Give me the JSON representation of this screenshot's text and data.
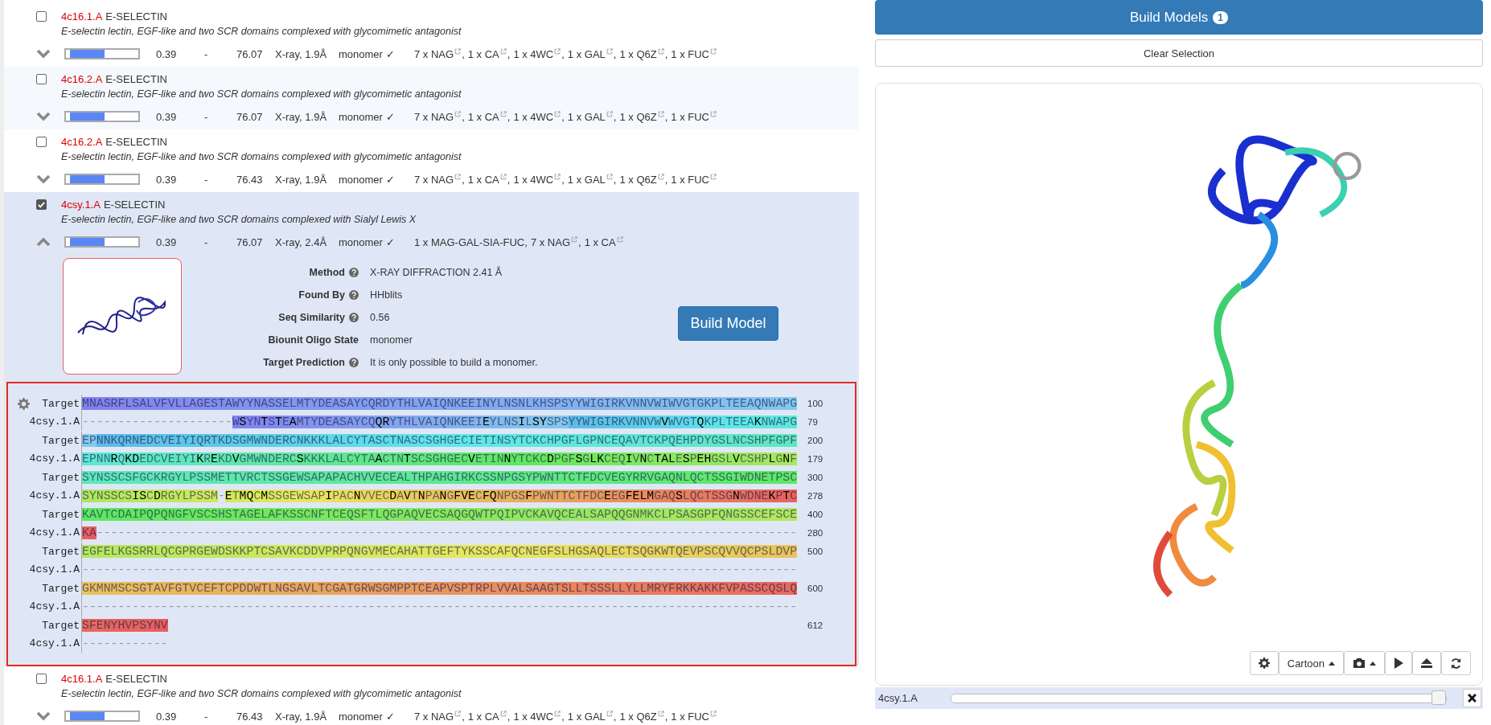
{
  "results": [
    {
      "id": "4c16.1.A",
      "name": "E-SELECTIN",
      "description": "E-selectin lectin, EGF-like and two SCR domains complexed with glycomimetic antagonist",
      "selected": false,
      "expanded": false,
      "level": 0.48,
      "column_3": "0.39",
      "column_4": "-",
      "column_5": "76.07",
      "column_6": "X-ray, 1.9Å",
      "column_7": "monomer ✓",
      "ligands": [
        {
          "text": "7 x NAG",
          "link": true,
          "separator": ","
        },
        {
          "text": "1 x CA",
          "link": true,
          "separator": ","
        },
        {
          "text": "1 x 4WC",
          "link": true,
          "separator": ","
        },
        {
          "text": "1 x GAL",
          "link": true,
          "separator": ","
        },
        {
          "text": "1 x Q6Z",
          "link": true,
          "separator": ","
        },
        {
          "text": "1 x FUC",
          "link": true
        }
      ]
    },
    {
      "id": "4c16.2.A",
      "name": "E-SELECTIN",
      "description": "E-selectin lectin, EGF-like and two SCR domains complexed with glycomimetic antagonist",
      "selected": false,
      "expanded": false,
      "level": 0.48,
      "column_3": "0.39",
      "column_4": "-",
      "column_5": "76.07",
      "column_6": "X-ray, 1.9Å",
      "column_7": "monomer ✓",
      "ligands": [
        {
          "text": "7 x NAG",
          "link": true,
          "separator": ","
        },
        {
          "text": "1 x CA",
          "link": true,
          "separator": ","
        },
        {
          "text": "1 x 4WC",
          "link": true,
          "separator": ","
        },
        {
          "text": "1 x GAL",
          "link": true,
          "separator": ","
        },
        {
          "text": "1 x Q6Z",
          "link": true,
          "separator": ","
        },
        {
          "text": "1 x FUC",
          "link": true
        }
      ]
    },
    {
      "id": "4c16.2.A",
      "name": "E-SELECTIN",
      "description": "E-selectin lectin, EGF-like and two SCR domains complexed with glycomimetic antagonist",
      "selected": false,
      "expanded": false,
      "level": 0.48,
      "column_3": "0.39",
      "column_4": "-",
      "column_5": "76.43",
      "column_6": "X-ray, 1.9Å",
      "column_7": "monomer ✓",
      "ligands": [
        {
          "text": "7 x NAG",
          "link": true,
          "separator": ","
        },
        {
          "text": "1 x CA",
          "link": true,
          "separator": ","
        },
        {
          "text": "1 x 4WC",
          "link": true,
          "separator": ","
        },
        {
          "text": "1 x GAL",
          "link": true,
          "separator": ","
        },
        {
          "text": "1 x Q6Z",
          "link": true,
          "separator": ","
        },
        {
          "text": "1 x FUC",
          "link": true
        }
      ]
    },
    {
      "id": "4csy.1.A",
      "name": "E-SELECTIN",
      "description": "E-selectin lectin, EGF-like and two SCR domains complexed with Sialyl Lewis X",
      "selected": true,
      "expanded": true,
      "level": 0.48,
      "column_3": "0.39",
      "column_4": "-",
      "column_5": "76.07",
      "column_6": "X-ray, 2.4Å",
      "column_7": "monomer ✓",
      "ligands": [
        {
          "text": "1 x MAG-GAL-SIA-FUC",
          "link": false,
          "separator": ","
        },
        {
          "text": "7 x NAG",
          "link": true,
          "separator": ","
        },
        {
          "text": "1 x CA",
          "link": true
        }
      ],
      "details": {
        "fields": [
          {
            "label": "Method",
            "help": true,
            "value": "X-RAY DIFFRACTION 2.41 Å"
          },
          {
            "label": "Found By",
            "help": true,
            "value": "HHblits"
          },
          {
            "label": "Seq Similarity",
            "help": true,
            "value": "0.56"
          },
          {
            "label": "Biounit Oligo State",
            "help": false,
            "value": "monomer"
          },
          {
            "label": "Target Prediction",
            "help": true,
            "value": "It is only possible to build a monomer."
          }
        ],
        "build_button": "Build Model",
        "alignment": [
          {
            "target_label": "Target",
            "target": "MNASRFLSALVFVLLAGESTAWYYNASSELMTYDEASAYCQRDYTHLVAIQNKEEINYLNSNLKHSPSYYWIGIRKVNNVWIWVGTGKPLTEEAQNWAPG",
            "target_end": "100",
            "template_label": "4csy.1.A",
            "template": "---------------------WSYNTSTEAMTYDEASAYCQQRYTHLVAIQNKEEIEYLNSILSYSPSYYWIGIRKVNNVWVWVGTQKPLTEEAKNWAPG",
            "template_end": "79"
          },
          {
            "target_label": "Target",
            "target": "EPNNKQRNEDCVEIYIQRTKDSGMWNDERCNKKKLALCYTASCTNASCSGHGECIETINSYTCKCHPGFLGPNCEQAVTCKPQEHPDYGSLNCSHPFGPF",
            "target_end": "200",
            "template_label": "4csy.1.A",
            "template": "EPNNRQKDEDCVEIYIKREKDVGMWNDERCSKKKLALCYTAACTNTSCSGHGECVETINNYTCKCDPGFSGLKCEQIVNCTALESPEHGSLVCSHPLGNF",
            "template_end": "179"
          },
          {
            "target_label": "Target",
            "target": "SYNSSCSFGCKRGYLPSSMETTVRCTSSGEWSAPAPACHVVECEALTHPAHGIRKCSSNPGSYPWNTTCTFDCVEGYRRVGAQNLQCTSSGIWDNETPSC",
            "target_end": "300",
            "template_label": "4csy.1.A",
            "template": "SYNSSCSISCDRGYLPSSM-ETMQCMSSGEWSAPIPACNVVECDAVTNPANGFVECFQNPGSFPWNTTCTFDCEEGFELMGAQSLQCTSSGNWDNEKPTC",
            "template_end": "278"
          },
          {
            "target_label": "Target",
            "target": "KAVTCDAIPQPQNGFVSCSHSTAGELAFKSSCNFTCEQSFTLQGPAQVECSAQGQWTPQIPVCKAVQCEALSAPQQGNMKCLPSASGPFQNGSSCEFSCE",
            "target_end": "400",
            "template_label": "4csy.1.A",
            "template": "KA--------------------------------------------------------------------------------------------------",
            "template_end": "280"
          },
          {
            "target_label": "Target",
            "target": "EGFELKGSRRLQCGPRGEWDSKKPTCSAVKCDDVPRPQNGVMECAHATTGEFTYKSSCAFQCNEGFSLHGSAQLECTSQGKWTQEVPSCQVVQCPSLDVP",
            "target_end": "500",
            "template_label": "4csy.1.A",
            "template": "----------------------------------------------------------------------------------------------------"
          },
          {
            "target_label": "Target",
            "target": "GKMNMSCSGTAVFGTVCEFTCPDDWTLNGSAVLTCGATGRWSGMPPTCEAPVSPTRPLVVALSAAGTSLLTSSSLLYLLMRYFRKKAKKFVPASSCQSLQ",
            "target_end": "600",
            "template_label": "4csy.1.A",
            "template": "----------------------------------------------------------------------------------------------------"
          },
          {
            "target_label": "Target",
            "target": "SFENYHVPSYNV",
            "target_end": "612",
            "template_label": "4csy.1.A",
            "template": "------------"
          }
        ]
      }
    },
    {
      "id": "4c16.1.A",
      "name": "E-SELECTIN",
      "description": "E-selectin lectin, EGF-like and two SCR domains complexed with glycomimetic antagonist",
      "selected": false,
      "expanded": false,
      "level": 0.48,
      "column_3": "0.39",
      "column_4": "-",
      "column_5": "76.43",
      "column_6": "X-ray, 1.9Å",
      "column_7": "monomer ✓",
      "ligands": [
        {
          "text": "7 x NAG",
          "link": true,
          "separator": ","
        },
        {
          "text": "1 x CA",
          "link": true,
          "separator": ","
        },
        {
          "text": "1 x 4WC",
          "link": true,
          "separator": ","
        },
        {
          "text": "1 x GAL",
          "link": true,
          "separator": ","
        },
        {
          "text": "1 x Q6Z",
          "link": true,
          "separator": ","
        },
        {
          "text": "1 x FUC",
          "link": true
        }
      ]
    }
  ],
  "build_models": {
    "label": "Build Models",
    "badge": "1"
  },
  "clear_button": "Clear Selection",
  "viewer": {
    "toolbar": [
      {
        "kind": "settings"
      },
      {
        "kind": "dropdown",
        "label": "Cartoon"
      },
      {
        "kind": "camera"
      },
      {
        "kind": "play"
      },
      {
        "kind": "eject"
      },
      {
        "kind": "refresh"
      }
    ]
  },
  "model_bar": {
    "label": "4csy.1.A",
    "level": 1
  }
}
